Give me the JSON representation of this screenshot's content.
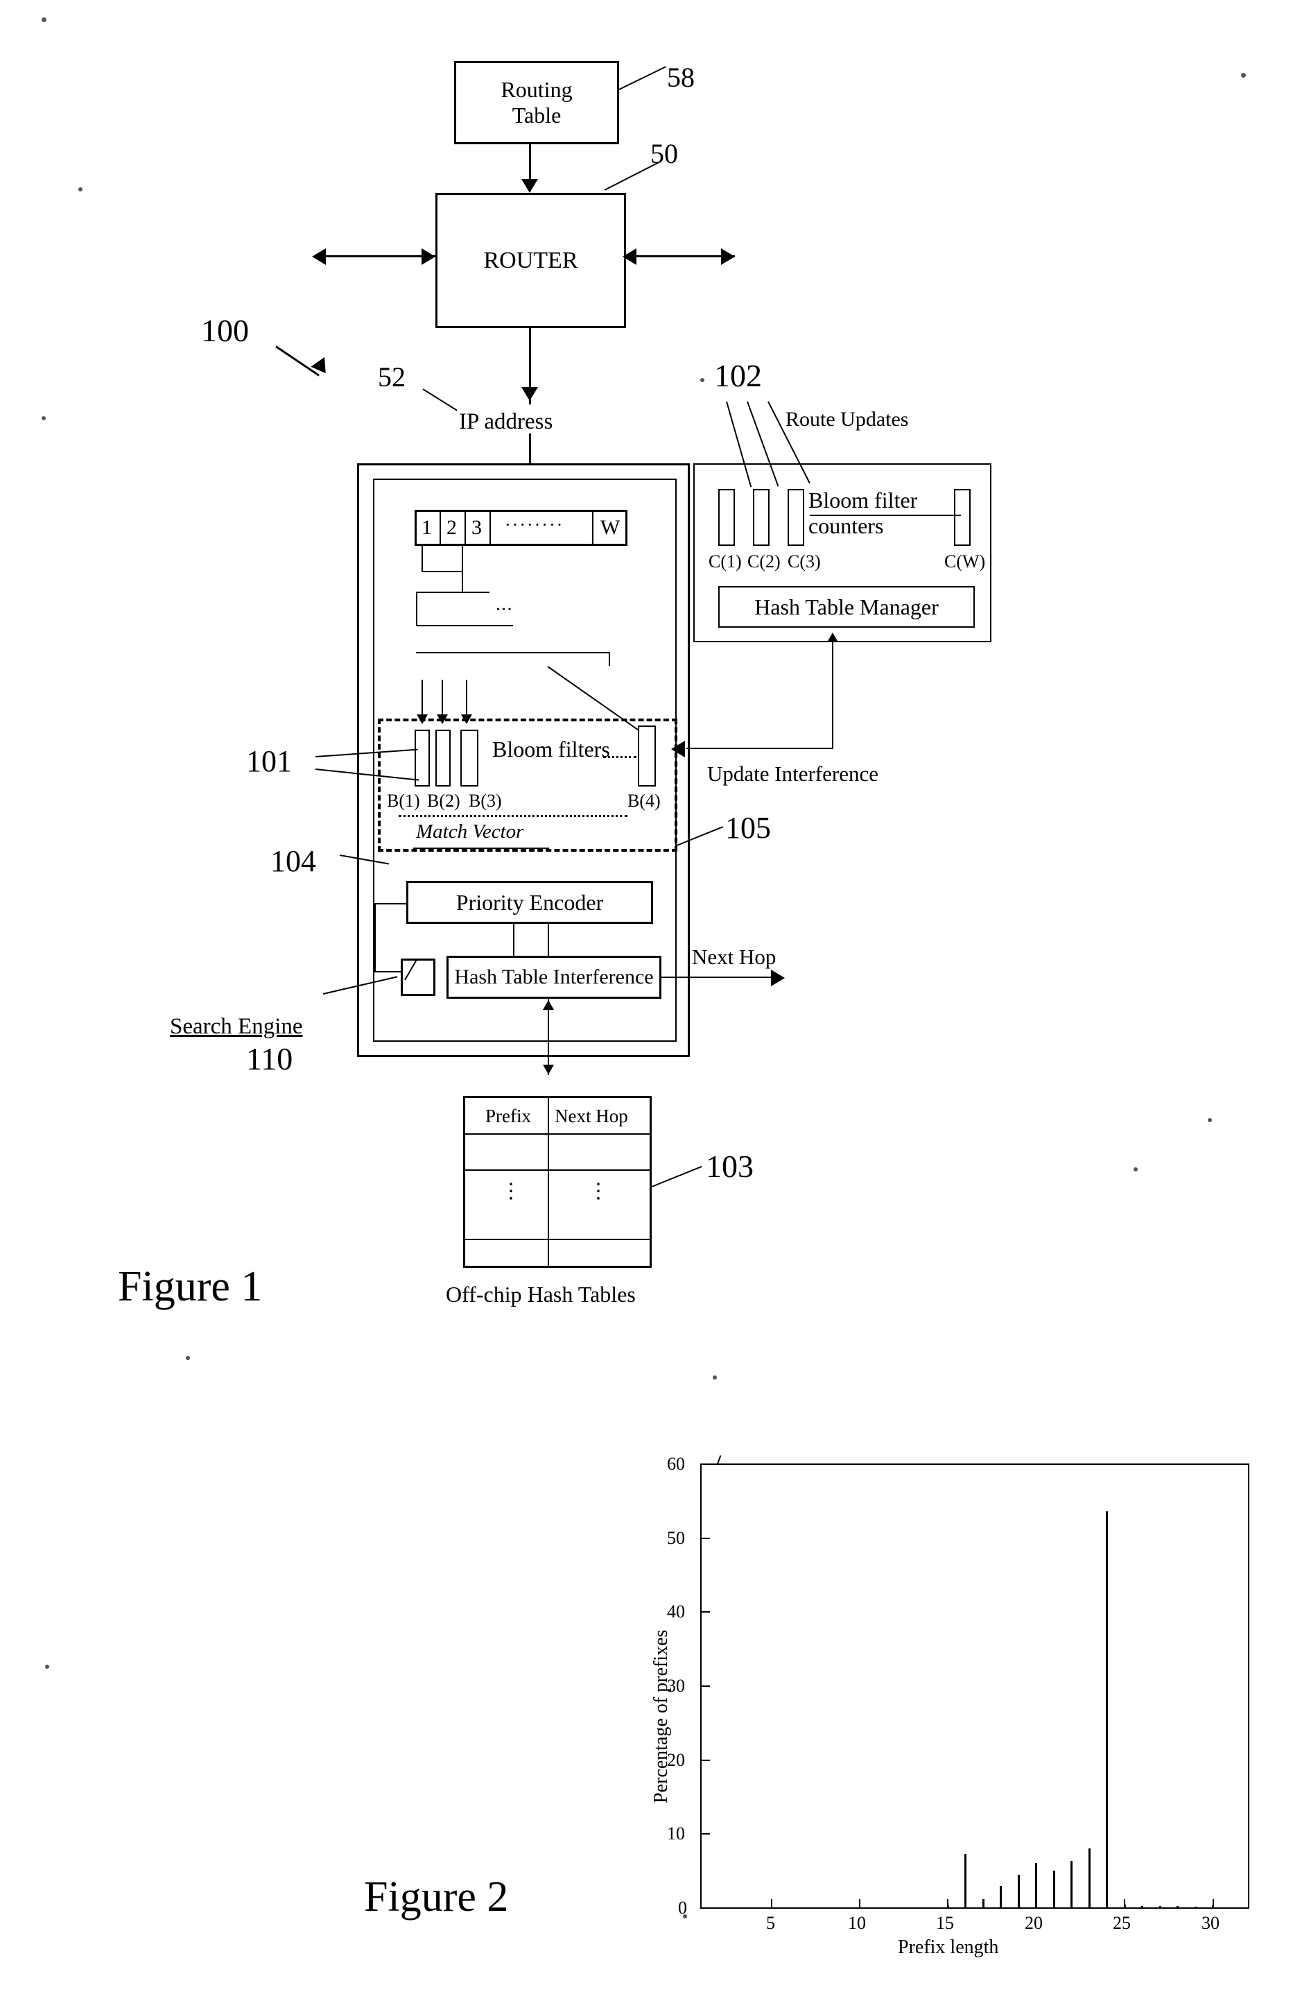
{
  "figure1": {
    "caption": "Figure 1",
    "blocks": {
      "routing_table": "Routing\nTable",
      "router": "ROUTER",
      "hash_table_manager": "Hash Table Manager",
      "priority_encoder": "Priority Encoder",
      "hash_table_interference": "Hash Table Interference",
      "bloom_filters": "Bloom filters",
      "bloom_filter_counters": "Bloom filter\ncounters",
      "match_vector": "Match Vector"
    },
    "labels": {
      "ip_address": "IP address",
      "route_updates": "Route Updates",
      "update_interference": "Update Interference",
      "next_hop": "Next Hop",
      "search_engine": "Search Engine",
      "off_chip_hash_tables": "Off-chip Hash Tables"
    },
    "refs": {
      "r58": "58",
      "r50": "50",
      "r100": "100",
      "r52": "52",
      "r102": "102",
      "r101": "101",
      "r104": "104",
      "r105": "105",
      "r110": "110",
      "r103": "103"
    },
    "word_array": [
      "1",
      "2",
      "3",
      "········",
      "W"
    ],
    "counter_labels": [
      "C(1)",
      "C(2)",
      "C(3)",
      "C(W)"
    ],
    "filter_labels": [
      "B(1)",
      "B(2)",
      "B(3)",
      "B(4)"
    ],
    "hash_table": {
      "headers": [
        "Prefix",
        "Next Hop"
      ],
      "rows": [
        [
          "",
          ""
        ],
        [
          "⋮",
          "⋮"
        ],
        [
          "",
          ""
        ]
      ]
    }
  },
  "figure2": {
    "caption": "Figure 2",
    "chart_data": {
      "type": "bar",
      "title": "",
      "xlabel": "Prefix length",
      "ylabel": "Percentage of prefixes",
      "xlim": [
        1,
        32
      ],
      "ylim": [
        0,
        60
      ],
      "xticks": [
        5,
        10,
        15,
        20,
        25,
        30
      ],
      "yticks": [
        0,
        10,
        20,
        30,
        40,
        50,
        60
      ],
      "grid": false,
      "legend": null,
      "categories": [
        1,
        2,
        3,
        4,
        5,
        6,
        7,
        8,
        9,
        10,
        11,
        12,
        13,
        14,
        15,
        16,
        17,
        18,
        19,
        20,
        21,
        22,
        23,
        24,
        25,
        26,
        27,
        28,
        29,
        30,
        31,
        32
      ],
      "values": [
        0,
        0,
        0,
        0,
        0,
        0,
        0,
        0,
        0,
        0,
        0,
        0,
        0,
        0,
        0.3,
        7.2,
        1.1,
        2.9,
        4.4,
        6.0,
        5.0,
        6.3,
        8.0,
        53.5,
        0.4,
        0.2,
        0.2,
        0.2,
        0.1,
        0.3,
        0,
        0
      ]
    }
  }
}
